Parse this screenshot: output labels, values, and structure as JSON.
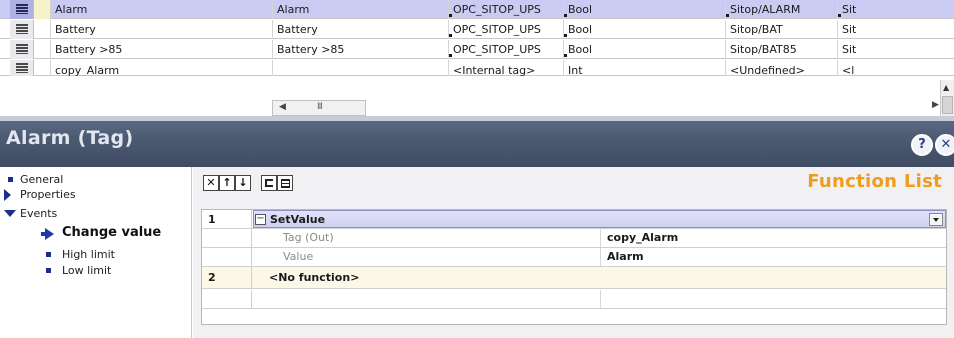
{
  "tag_table": {
    "rows": [
      {
        "name": "Alarm",
        "display_name": "Alarm",
        "connection": "OPC_SITOP_UPS",
        "data_type": "Bool",
        "address": "Sitop/ALARM",
        "extra": "Sit",
        "selected": true
      },
      {
        "name": "Battery",
        "display_name": "Battery",
        "connection": "OPC_SITOP_UPS",
        "data_type": "Bool",
        "address": "Sitop/BAT",
        "extra": "Sit",
        "selected": false
      },
      {
        "name": "Battery >85",
        "display_name": "Battery >85",
        "connection": "OPC_SITOP_UPS",
        "data_type": "Bool",
        "address": "Sitop/BAT85",
        "extra": "Sit",
        "selected": false
      },
      {
        "name": "copy_Alarm",
        "display_name": "",
        "connection": "<Internal tag>",
        "data_type": "Int",
        "address": "<Undefined>",
        "extra": "<l",
        "selected": false
      }
    ],
    "hscroll_left": "◀",
    "hscroll_grip": "III",
    "hscroll_right": "▶",
    "vscroll_up": "▲"
  },
  "inspector": {
    "title": "Alarm (Tag)",
    "help_icon": "pin-help-icon",
    "help_glyph": "?",
    "close_glyph": "✕",
    "nav": {
      "general": "General",
      "properties": "Properties",
      "events": "Events",
      "change_value": "Change value",
      "high_limit": "High limit",
      "low_limit": "Low limit"
    },
    "toolbar": {
      "delete_glyph": "✕",
      "up_glyph": "↑",
      "down_glyph": "↓"
    },
    "function_list_title": "Function List",
    "functions": {
      "row1_num": "1",
      "row1_name": "SetValue",
      "param1_name": "Tag (Out)",
      "param1_value": "copy_Alarm",
      "param2_name": "Value",
      "param2_value": "Alarm",
      "row2_num": "2",
      "row2_name": "<No function>",
      "minus_glyph": "−"
    }
  },
  "colors": {
    "selected_row": "#c9cbf2",
    "header_bar": "#4d5b72",
    "function_list_title": "#f09c1e",
    "nav_accent": "#1a2e8a"
  }
}
